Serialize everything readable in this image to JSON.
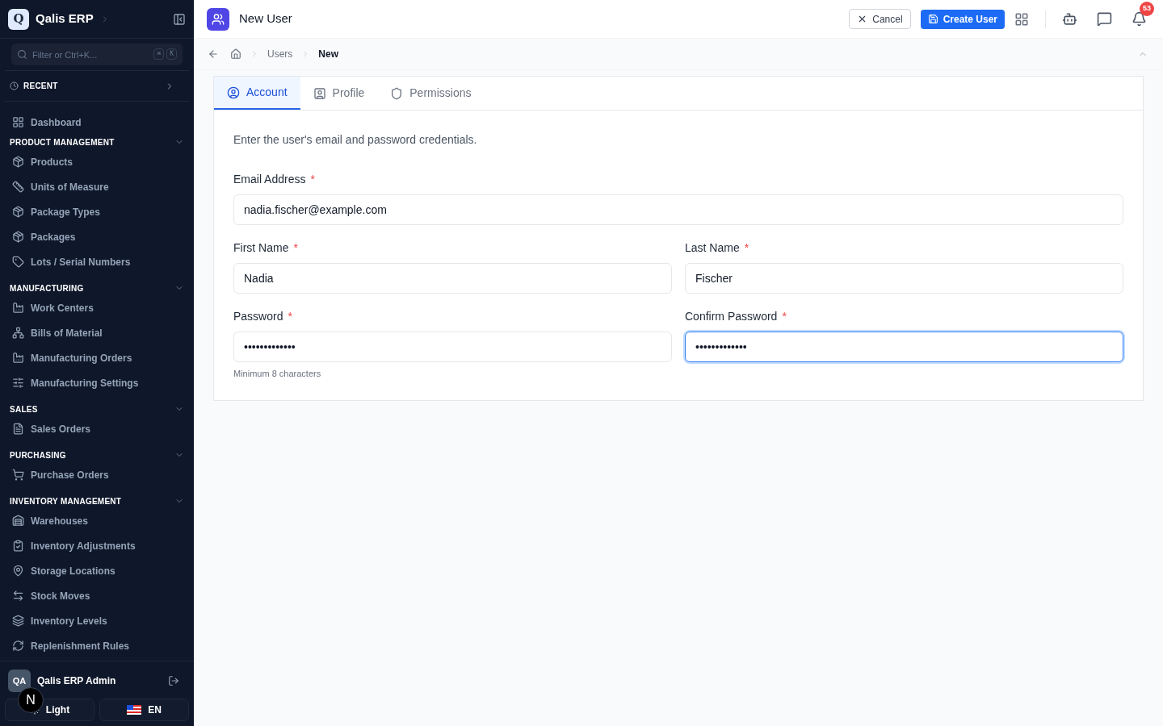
{
  "sidebar": {
    "brand": {
      "logo": "Q",
      "name": "Qalis ERP"
    },
    "search": {
      "placeholder": "Filter or Ctrl+K...",
      "keys": [
        "⌘",
        "K"
      ]
    },
    "recent": "RECENT",
    "sections": [
      {
        "items": [
          "Dashboard"
        ]
      },
      {
        "title": "PRODUCT MANAGEMENT",
        "items": [
          "Products",
          "Units of Measure",
          "Package Types",
          "Packages",
          "Lots / Serial Numbers"
        ]
      },
      {
        "title": "MANUFACTURING",
        "items": [
          "Work Centers",
          "Bills of Material",
          "Manufacturing Orders",
          "Manufacturing Settings"
        ]
      },
      {
        "title": "SALES",
        "items": [
          "Sales Orders"
        ]
      },
      {
        "title": "PURCHASING",
        "items": [
          "Purchase Orders"
        ]
      },
      {
        "title": "INVENTORY MANAGEMENT",
        "items": [
          "Warehouses",
          "Inventory Adjustments",
          "Storage Locations",
          "Stock Moves",
          "Inventory Levels",
          "Replenishment Rules"
        ]
      }
    ],
    "user": {
      "initials": "QA",
      "name": "Qalis ERP Admin"
    },
    "theme_button": "Light",
    "language_button": "EN",
    "dev_badge": "N"
  },
  "header": {
    "title": "New User",
    "cancel": "Cancel",
    "create": "Create User",
    "notifications": "53"
  },
  "breadcrumbs": [
    {
      "label": "Users",
      "current": false
    },
    {
      "label": "New",
      "current": true
    }
  ],
  "tabs": [
    {
      "label": "Account",
      "selected": true
    },
    {
      "label": "Profile",
      "selected": false
    },
    {
      "label": "Permissions",
      "selected": false
    }
  ],
  "form": {
    "intro": "Enter the user's email and password credentials.",
    "rows": [
      [
        {
          "label": "Email Address",
          "required_mark": "*",
          "value": "nadia.fischer@example.com",
          "focused": false
        }
      ],
      [
        {
          "label": "First Name",
          "required_mark": "*",
          "value": "Nadia",
          "focused": false
        },
        {
          "label": "Last Name",
          "required_mark": "*",
          "value": "Fischer",
          "focused": false
        }
      ],
      [
        {
          "label": "Password",
          "required_mark": "*",
          "value": "•••••••••••••",
          "focused": false,
          "hint": "Minimum 8 characters"
        },
        {
          "label": "Confirm Password",
          "required_mark": "*",
          "value": "•••••••••••••",
          "focused": true
        }
      ]
    ]
  }
}
